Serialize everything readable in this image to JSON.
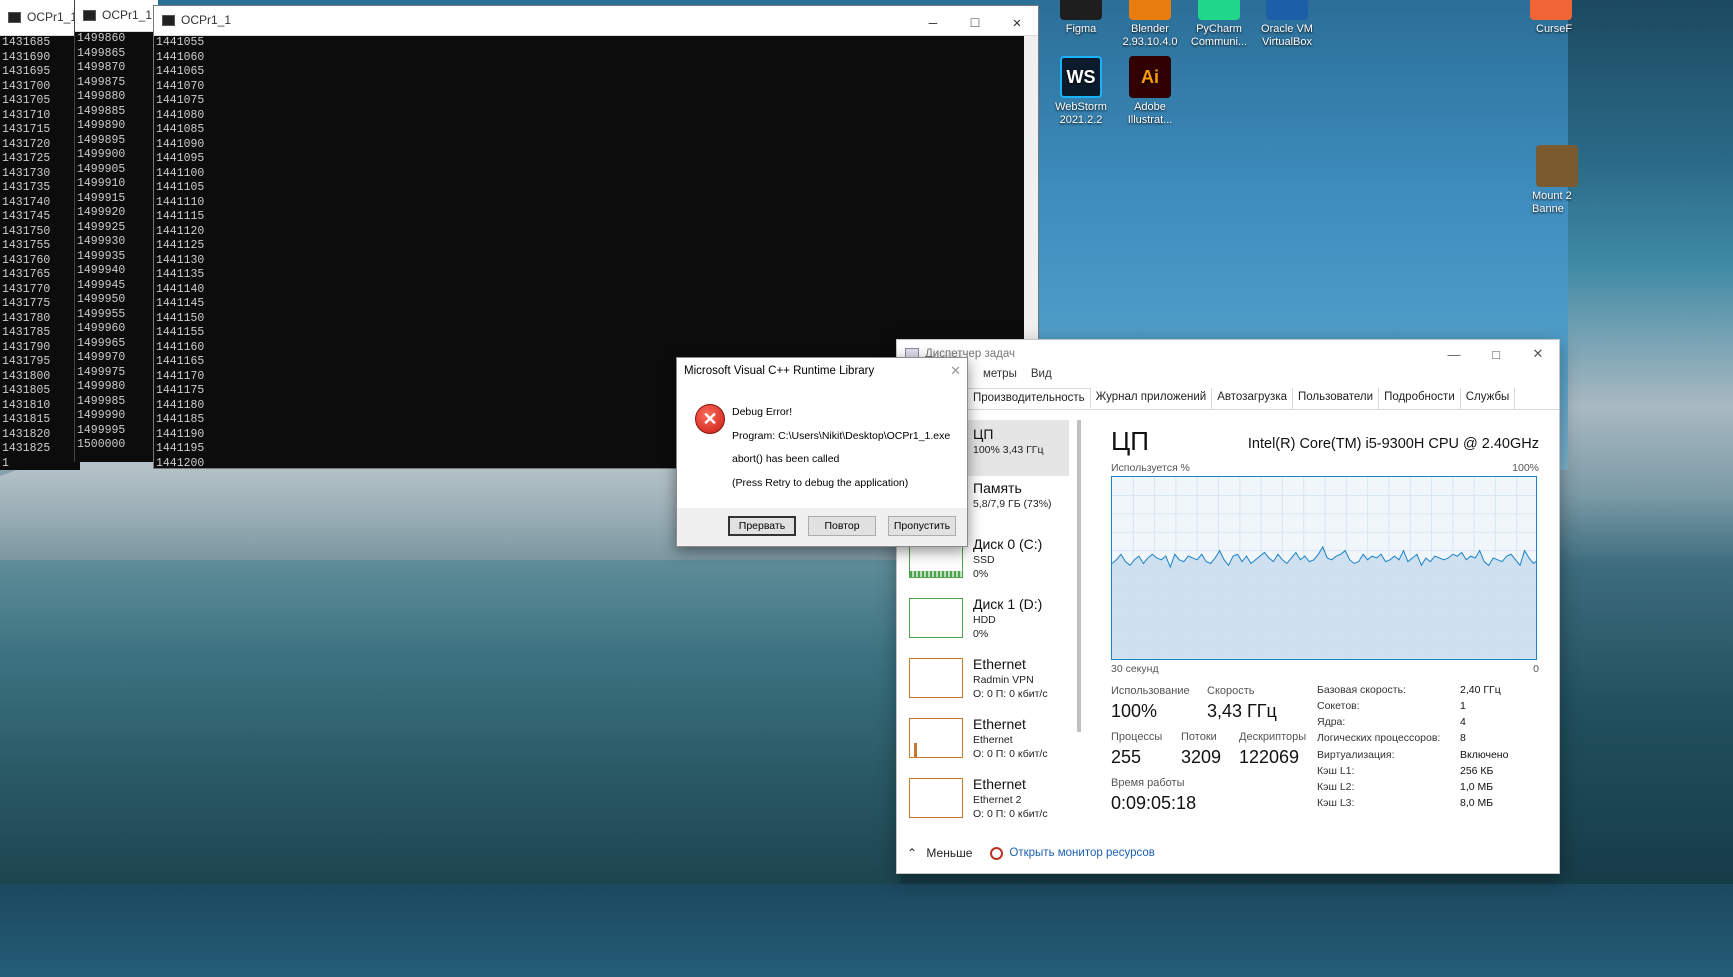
{
  "desktop_icons": [
    {
      "label": "Figma",
      "color": "#1e1e1e"
    },
    {
      "label": "Blender 2.93.10.4.0",
      "color": "#e87d0d"
    },
    {
      "label": "PyCharm Communi...",
      "color": "#21d789"
    },
    {
      "label": "Oracle VM VirtualBox",
      "color": "#1d5ea8"
    },
    {
      "label": "CurseF",
      "color": "#f16436"
    },
    {
      "label": "WebStorm 2021.2.2",
      "color": "#0b1b2b",
      "glyph": "WS"
    },
    {
      "label": "Adobe Illustrat...",
      "color": "#310000",
      "glyph": "Ai"
    },
    {
      "label": "Mount 2 Banne",
      "color": "#7a5a2f"
    }
  ],
  "consoles": [
    {
      "title": "OCPr1_1",
      "lines": [
        "1431685",
        "1431690",
        "1431695",
        "1431700",
        "1431705",
        "1431710",
        "1431715",
        "1431720",
        "1431725",
        "1431730",
        "1431735",
        "1431740",
        "1431745",
        "1431750",
        "1431755",
        "1431760",
        "1431765",
        "1431770",
        "1431775",
        "1431780",
        "1431785",
        "1431790",
        "1431795",
        "1431800",
        "1431805",
        "1431810",
        "1431815",
        "1431820",
        "1431825",
        "1"
      ]
    },
    {
      "title": "OCPr1_1",
      "lines": [
        "1499860",
        "1499865",
        "1499870",
        "1499875",
        "1499880",
        "1499885",
        "1499890",
        "1499895",
        "1499900",
        "1499905",
        "1499910",
        "1499915",
        "1499920",
        "1499925",
        "1499930",
        "1499935",
        "1499940",
        "1499945",
        "1499950",
        "1499955",
        "1499960",
        "1499965",
        "1499970",
        "1499975",
        "1499980",
        "1499985",
        "1499990",
        "1499995",
        "1500000"
      ]
    },
    {
      "title": "OCPr1_1",
      "lines": [
        "1441055",
        "1441060",
        "1441065",
        "1441070",
        "1441075",
        "1441080",
        "1441085",
        "1441090",
        "1441095",
        "1441100",
        "1441105",
        "1441110",
        "1441115",
        "1441120",
        "1441125",
        "1441130",
        "1441135",
        "1441140",
        "1441145",
        "1441150",
        "1441155",
        "1441160",
        "1441165",
        "1441170",
        "1441175",
        "1441180",
        "1441185",
        "1441190",
        "1441195",
        "1441200"
      ]
    }
  ],
  "dialog": {
    "title": "Microsoft Visual C++ Runtime Library",
    "heading": "Debug Error!",
    "program": "Program: C:\\Users\\Nikit\\Desktop\\OCPr1_1.exe",
    "message": "abort() has been called",
    "hint": "(Press Retry to debug the application)",
    "buttons": {
      "abort": "Прервать",
      "retry": "Повтор",
      "ignore": "Пропустить"
    }
  },
  "taskmgr": {
    "title": "Диспетчер задач",
    "menu": [
      "метры",
      "Вид"
    ],
    "tabs": [
      "Производительность",
      "Журнал приложений",
      "Автозагрузка",
      "Пользователи",
      "Подробности",
      "Службы"
    ],
    "sidebar": [
      {
        "name": "ЦП",
        "sub1": "100% 3,43 ГГц",
        "sub2": ""
      },
      {
        "name": "Память",
        "sub1": "5,8/7,9 ГБ (73%)",
        "sub2": ""
      },
      {
        "name": "Диск 0 (C:)",
        "sub1": "SSD",
        "sub2": "0%"
      },
      {
        "name": "Диск 1 (D:)",
        "sub1": "HDD",
        "sub2": "0%"
      },
      {
        "name": "Ethernet",
        "sub1": "Radmin VPN",
        "sub2": "О: 0 П: 0 кбит/с"
      },
      {
        "name": "Ethernet",
        "sub1": "Ethernet",
        "sub2": "О: 0 П: 0 кбит/с"
      },
      {
        "name": "Ethernet",
        "sub1": "Ethernet 2",
        "sub2": "О: 0 П: 0 кбит/с"
      }
    ],
    "cpu": {
      "heading": "ЦП",
      "model": "Intel(R) Core(TM) i5-9300H CPU @ 2.40GHz",
      "usage_label": "Используется %",
      "max_label": "100%",
      "time_label": "30 секунд",
      "zero_label": "0",
      "usage_history": [
        53,
        55,
        58,
        54,
        52,
        55,
        57,
        53,
        56,
        58,
        56,
        55,
        57,
        51,
        58,
        55,
        54,
        57,
        56,
        55,
        58,
        54,
        53,
        56,
        60,
        55,
        52,
        57,
        58,
        54,
        57,
        53,
        55,
        57,
        59,
        56,
        54,
        58,
        55,
        53,
        56,
        59,
        55,
        57,
        54,
        55,
        58,
        62,
        56,
        55,
        57,
        58,
        60,
        55,
        53,
        54,
        58,
        55,
        57,
        56,
        58,
        54,
        55,
        57,
        55,
        60,
        54,
        56,
        58,
        52,
        56,
        54,
        57,
        56,
        55,
        56,
        58,
        57,
        59,
        55,
        57,
        56,
        60,
        54,
        52,
        56,
        55,
        54,
        57,
        58,
        55,
        52,
        60,
        56,
        53,
        55
      ]
    },
    "stats": {
      "usage_label": "Использование",
      "usage_value": "100%",
      "speed_label": "Скорость",
      "speed_value": "3,43 ГГц",
      "proc_label": "Процессы",
      "proc_value": "255",
      "threads_label": "Потоки",
      "threads_value": "3209",
      "handles_label": "Дескрипторы",
      "handles_value": "122069",
      "uptime_label": "Время работы",
      "uptime_value": "0:09:05:18"
    },
    "specs": [
      {
        "k": "Базовая скорость:",
        "v": "2,40 ГГц"
      },
      {
        "k": "Сокетов:",
        "v": "1"
      },
      {
        "k": "Ядра:",
        "v": "4"
      },
      {
        "k": "Логических процессоров:",
        "v": "8"
      },
      {
        "k": "Виртуализация:",
        "v": "Включено"
      },
      {
        "k": "Кэш L1:",
        "v": "256 КБ"
      },
      {
        "k": "Кэш L2:",
        "v": "1,0 МБ"
      },
      {
        "k": "Кэш L3:",
        "v": "8,0 МБ"
      }
    ],
    "footer": {
      "less": "Меньше",
      "monitor": "Открыть монитор ресурсов"
    }
  }
}
